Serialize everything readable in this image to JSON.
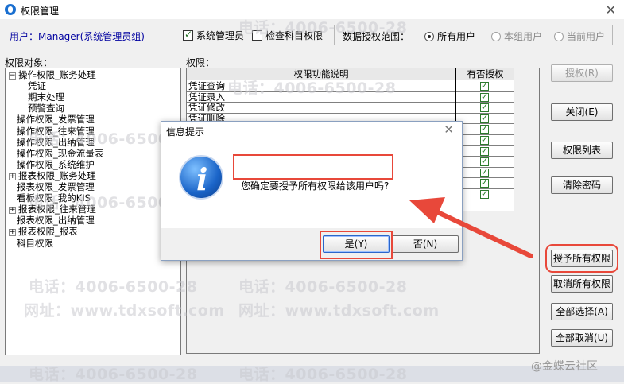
{
  "window": {
    "title": "权限管理"
  },
  "header": {
    "user_label": "用户：Manager(系统管理员组)",
    "sysadmin_label": "系统管理员",
    "sysadmin_checked": true,
    "check_subject_label": "检查科目权限",
    "check_subject_checked": false,
    "scope_label": "数据授权范围：",
    "scope_options": [
      "所有用户",
      "本组用户",
      "当前用户"
    ],
    "scope_selected": "所有用户"
  },
  "tree": {
    "label": "权限对象：",
    "nodes": [
      {
        "text": "操作权限_账务处理",
        "expander": "⊟"
      },
      {
        "text": "凭证",
        "expander": ""
      },
      {
        "text": "期末处理",
        "expander": ""
      },
      {
        "text": "预警查询",
        "expander": ""
      },
      {
        "text": "操作权限_发票管理",
        "expander": ""
      },
      {
        "text": "操作权限_往来管理",
        "expander": ""
      },
      {
        "text": "操作权限_出纳管理",
        "expander": ""
      },
      {
        "text": "操作权限_现金流量表",
        "expander": ""
      },
      {
        "text": "操作权限_系统维护",
        "expander": ""
      },
      {
        "text": "报表权限_账务处理",
        "expander": "⊞"
      },
      {
        "text": "报表权限_发票管理",
        "expander": ""
      },
      {
        "text": "看板权限_我的KIS",
        "expander": ""
      },
      {
        "text": "报表权限_往来管理",
        "expander": "⊞"
      },
      {
        "text": "报表权限_出纳管理",
        "expander": ""
      },
      {
        "text": "报表权限_报表",
        "expander": "⊞"
      },
      {
        "text": "科目权限",
        "expander": ""
      }
    ]
  },
  "permissions": {
    "label": "权限：",
    "columns": [
      "权限功能说明",
      "有否授权"
    ],
    "rows": [
      "凭证查询",
      "凭证录入",
      "凭证修改",
      "凭证删除",
      "",
      "",
      "",
      "",
      "",
      "",
      ""
    ]
  },
  "side_buttons": {
    "grant": "授权(R)",
    "close": "关闭(E)",
    "list": "权限列表",
    "clear_pwd": "清除密码",
    "grant_all": "授予所有权限",
    "revoke_all": "取消所有权限",
    "select_all": "全部选择(A)",
    "deselect_all": "全部取消(U)"
  },
  "dialog": {
    "title": "信息提示",
    "message": "您确定要授予所有权限给该用户吗?",
    "yes": "是(Y)",
    "no": "否(N)"
  },
  "watermark": {
    "phone": "电话：4006-6500-28",
    "site": "网址：www.tdxsoft.com"
  },
  "brand": "@金蝶云社区",
  "colors": {
    "highlight": "#e8483a",
    "check": "#1c7b1c",
    "user_text": "#0000a0"
  }
}
